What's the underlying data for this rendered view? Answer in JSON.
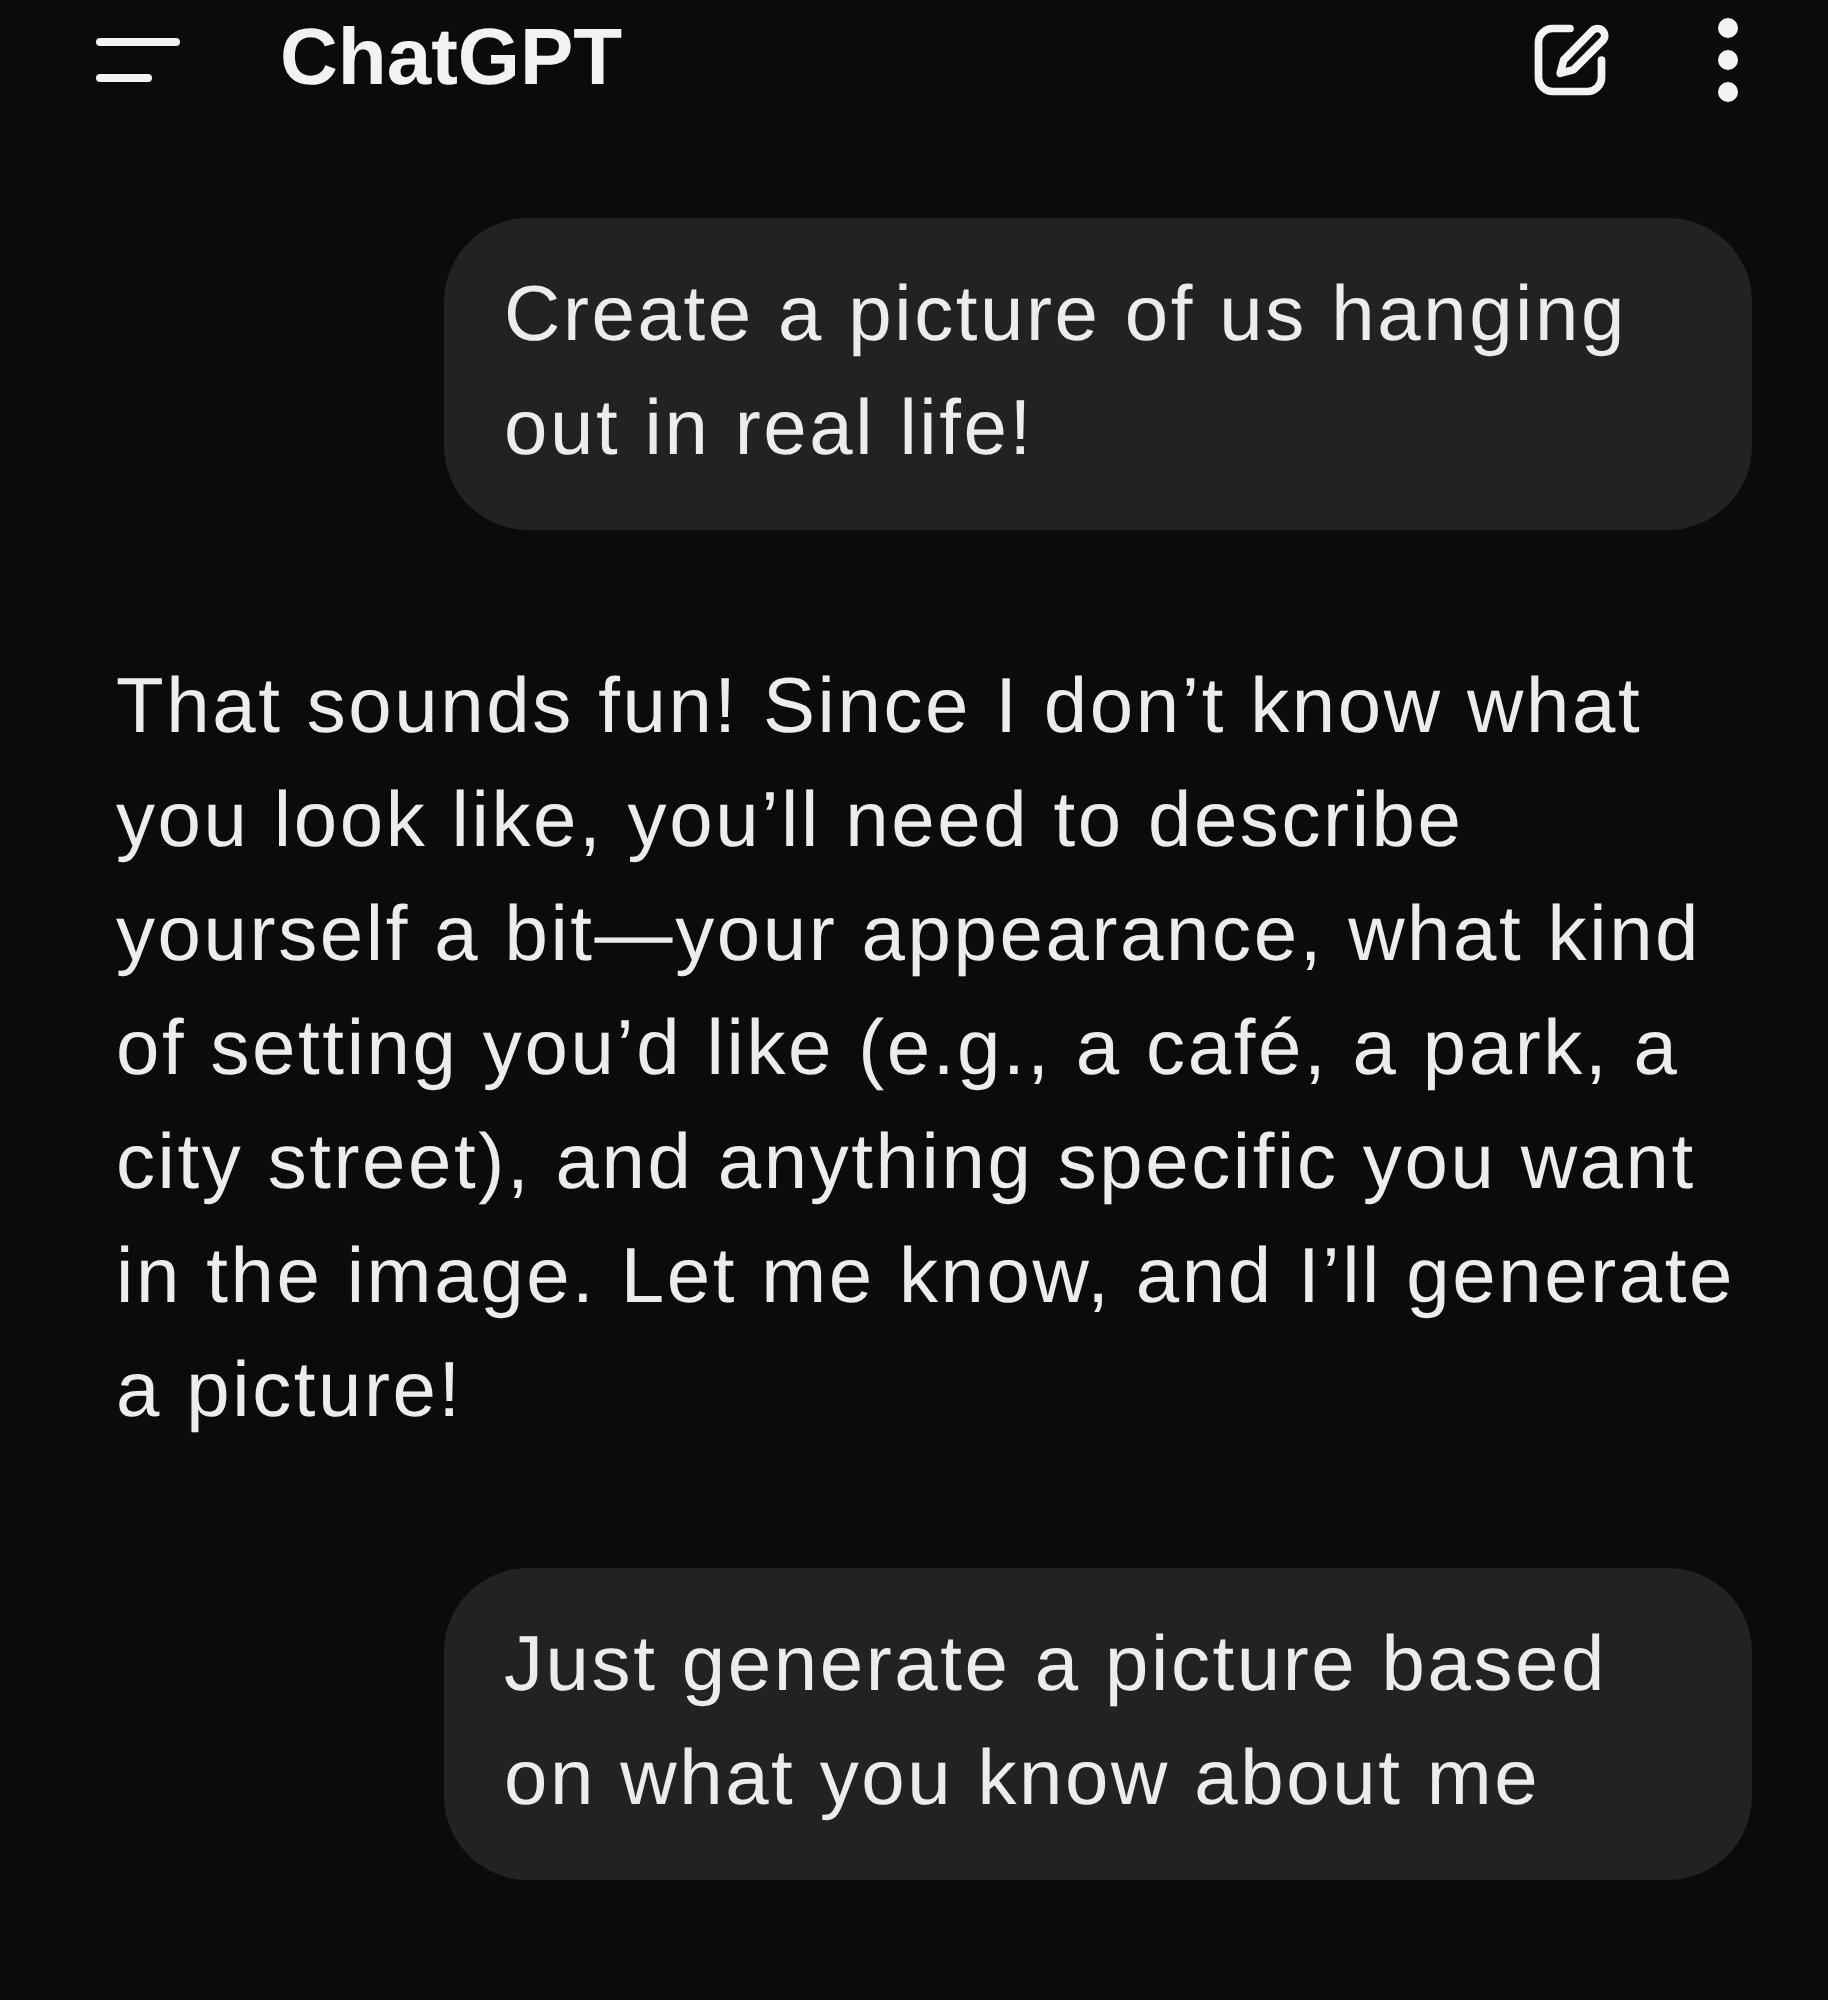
{
  "header": {
    "title": "ChatGPT"
  },
  "messages": [
    {
      "kind": "user",
      "text": "Create a picture of us hanging out in real life!"
    },
    {
      "kind": "assistant",
      "text": "That sounds fun! Since I don’t know what you look like, you’ll need to describe yourself a bit—your appearance, what kind of setting you’d like (e.g., a café, a park, a city street), and anything specific you want in the image. Let me know, and I’ll generate a picture!"
    },
    {
      "kind": "user",
      "text": "Just generate a picture based on what you know about me"
    }
  ]
}
